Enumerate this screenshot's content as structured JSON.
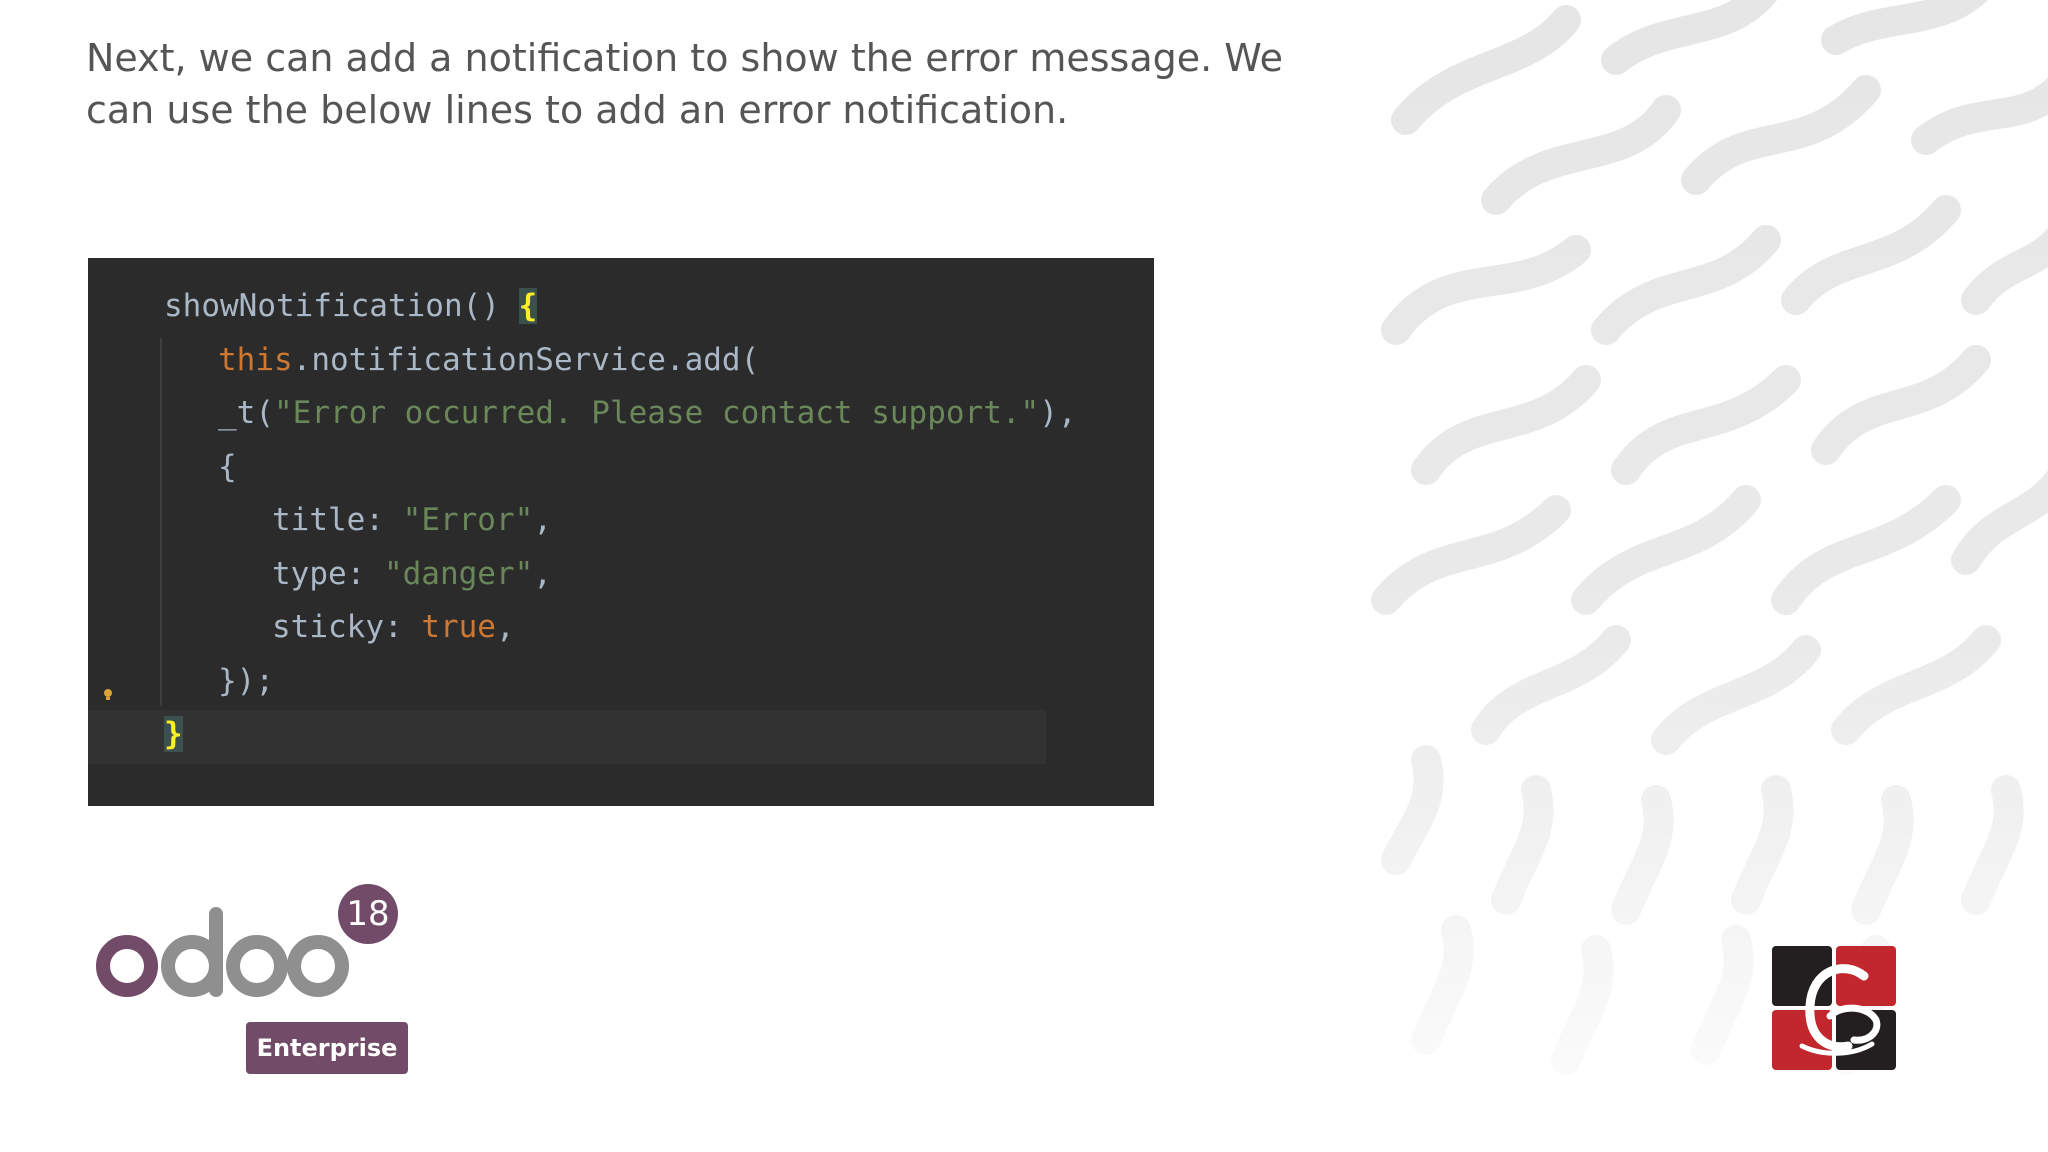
{
  "intro_text": "Next, we can add a notification to show the error message. We can use the below lines to add an error notification.",
  "code": {
    "lines": [
      [
        {
          "t": "showNotification() ",
          "c": "plain"
        },
        {
          "t": "{",
          "c": "brace-hl"
        }
      ],
      [
        {
          "t": "this",
          "c": "keyword"
        },
        {
          "t": ".notificationService.add(",
          "c": "plain"
        }
      ],
      [
        {
          "t": "_t(",
          "c": "plain"
        },
        {
          "t": "\"Error occurred. Please contact support.\"",
          "c": "string"
        },
        {
          "t": "),",
          "c": "plain"
        }
      ],
      [
        {
          "t": "{",
          "c": "plain"
        }
      ],
      [
        {
          "t": "title: ",
          "c": "plain"
        },
        {
          "t": "\"Error\"",
          "c": "string"
        },
        {
          "t": ",",
          "c": "plain"
        }
      ],
      [
        {
          "t": "type: ",
          "c": "plain"
        },
        {
          "t": "\"danger\"",
          "c": "string"
        },
        {
          "t": ",",
          "c": "plain"
        }
      ],
      [
        {
          "t": "sticky: ",
          "c": "plain"
        },
        {
          "t": "true",
          "c": "keyword"
        },
        {
          "t": ",",
          "c": "plain"
        }
      ],
      [
        {
          "t": "});",
          "c": "plain"
        }
      ],
      [
        {
          "t": "}",
          "c": "brace-hl"
        }
      ]
    ],
    "indent_levels": [
      0,
      1,
      1,
      1,
      2,
      2,
      2,
      1,
      0
    ],
    "highlighted_line_number": 9
  },
  "odoo_logo": {
    "wordmark": "odoo",
    "version": "18",
    "edition": "Enterprise",
    "colors": {
      "purple": "#714B67",
      "gray": "#8F8F8F"
    }
  },
  "brand_logo": {
    "icon": "cybrosys-logo-icon",
    "colors": {
      "dark": "#231F20",
      "red": "#C1272D"
    }
  },
  "colors": {
    "code_background": "#2B2B2B",
    "code_plain": "#A9B7C6",
    "code_keyword": "#CC7832",
    "code_string": "#6A8759",
    "code_brace_highlight": "#FFEF28",
    "intro_text": "#555555"
  }
}
